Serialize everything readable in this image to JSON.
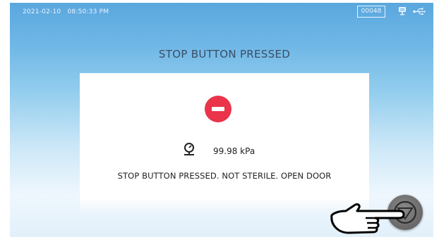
{
  "status_bar": {
    "date": "2021-02-10",
    "time": "08:50:33 PM",
    "counter": "00048",
    "icons": [
      "monitor-icon",
      "usb-icon"
    ]
  },
  "dialog": {
    "title": "STOP BUTTON PRESSED",
    "icon": "stop-icon",
    "pressure_icon": "gauge-icon",
    "pressure": "99.98 kPa",
    "message": "STOP BUTTON PRESSED. NOT STERILE. OPEN DOOR"
  },
  "stop_button": {
    "icon": "stop-triangle-icon"
  },
  "colors": {
    "alert_red": "#e9344a",
    "text_dark": "#222222",
    "title_text": "#3a4d66",
    "status_text": "#e8f4ff",
    "stop_button_gray": "#6f6f6f"
  }
}
